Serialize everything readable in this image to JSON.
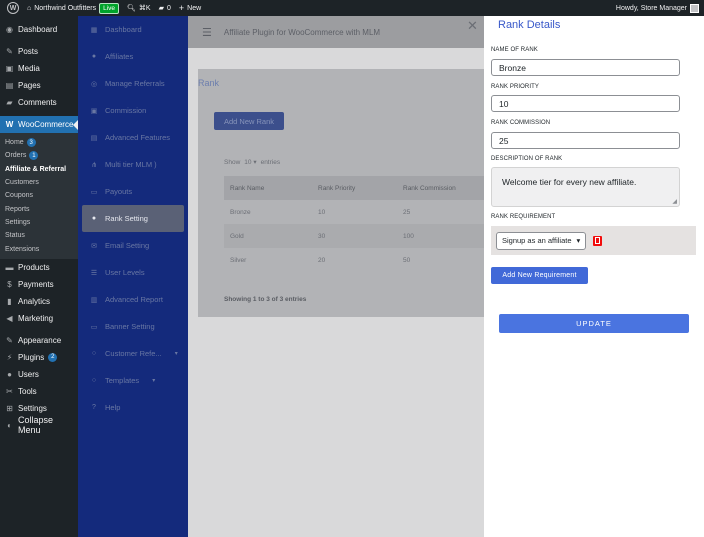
{
  "adminbar": {
    "site_name": "Northwind Outfitters",
    "live_badge": "Live",
    "search_shortcut": "⌘K",
    "comments_count": "0",
    "new_label": "New",
    "howdy": "Howdy, Store Manager"
  },
  "wpmenu": {
    "dashboard": "Dashboard",
    "posts": "Posts",
    "media": "Media",
    "pages": "Pages",
    "comments": "Comments",
    "woocommerce": "WooCommerce",
    "sub": {
      "home": "Home",
      "home_badge": "3",
      "orders": "Orders",
      "orders_badge": "1",
      "affiliate": "Affiliate & Referral",
      "customers": "Customers",
      "coupons": "Coupons",
      "reports": "Reports",
      "settings": "Settings",
      "status": "Status",
      "extensions": "Extensions"
    },
    "products": "Products",
    "payments": "Payments",
    "analytics": "Analytics",
    "marketing": "Marketing",
    "appearance": "Appearance",
    "plugins": "Plugins",
    "plugins_badge": "2",
    "users": "Users",
    "tools": "Tools",
    "settings": "Settings",
    "collapse": "Collapse Menu"
  },
  "plugin_sidebar": {
    "items": [
      {
        "label": "Dashboard"
      },
      {
        "label": "Affiliates"
      },
      {
        "label": "Manage Referrals"
      },
      {
        "label": "Commission"
      },
      {
        "label": "Advanced Features"
      },
      {
        "label": "Multi tier MLM )"
      },
      {
        "label": "Payouts"
      },
      {
        "label": "Rank Setting"
      },
      {
        "label": "Email Setting"
      },
      {
        "label": "User Levels"
      },
      {
        "label": "Advanced Report"
      },
      {
        "label": "Banner Setting"
      },
      {
        "label": "Customer Refe..."
      },
      {
        "label": "Templates"
      },
      {
        "label": "Help"
      }
    ]
  },
  "main": {
    "header_title": "Affiliate Plugin for WooCommerce with MLM",
    "rank_title": "Rank",
    "add_button": "Add New Rank",
    "show_label": "Show",
    "show_value": "10",
    "entries_label": "entries",
    "table": {
      "headers": [
        "Rank Name",
        "Rank Priority",
        "Rank Commission"
      ],
      "rows": [
        [
          "Bronze",
          "10",
          "25"
        ],
        [
          "Gold",
          "30",
          "100"
        ],
        [
          "Silver",
          "20",
          "50"
        ]
      ]
    },
    "showing": "Showing 1 to 3 of 3 entries"
  },
  "panel": {
    "title": "Rank Details",
    "name_label": "NAME OF RANK",
    "name_value": "Bronze",
    "priority_label": "RANK PRIORITY",
    "priority_value": "10",
    "commission_label": "RANK COMMISSION",
    "commission_value": "25",
    "description_label": "DESCRIPTION OF RANK",
    "description_value": "Welcome tier for every new affiliate.",
    "requirement_label": "RANK REQUIREMENT",
    "requirement_value": "Signup as an affiliate",
    "add_requirement": "Add New Requirement",
    "update": "UPDATE"
  }
}
